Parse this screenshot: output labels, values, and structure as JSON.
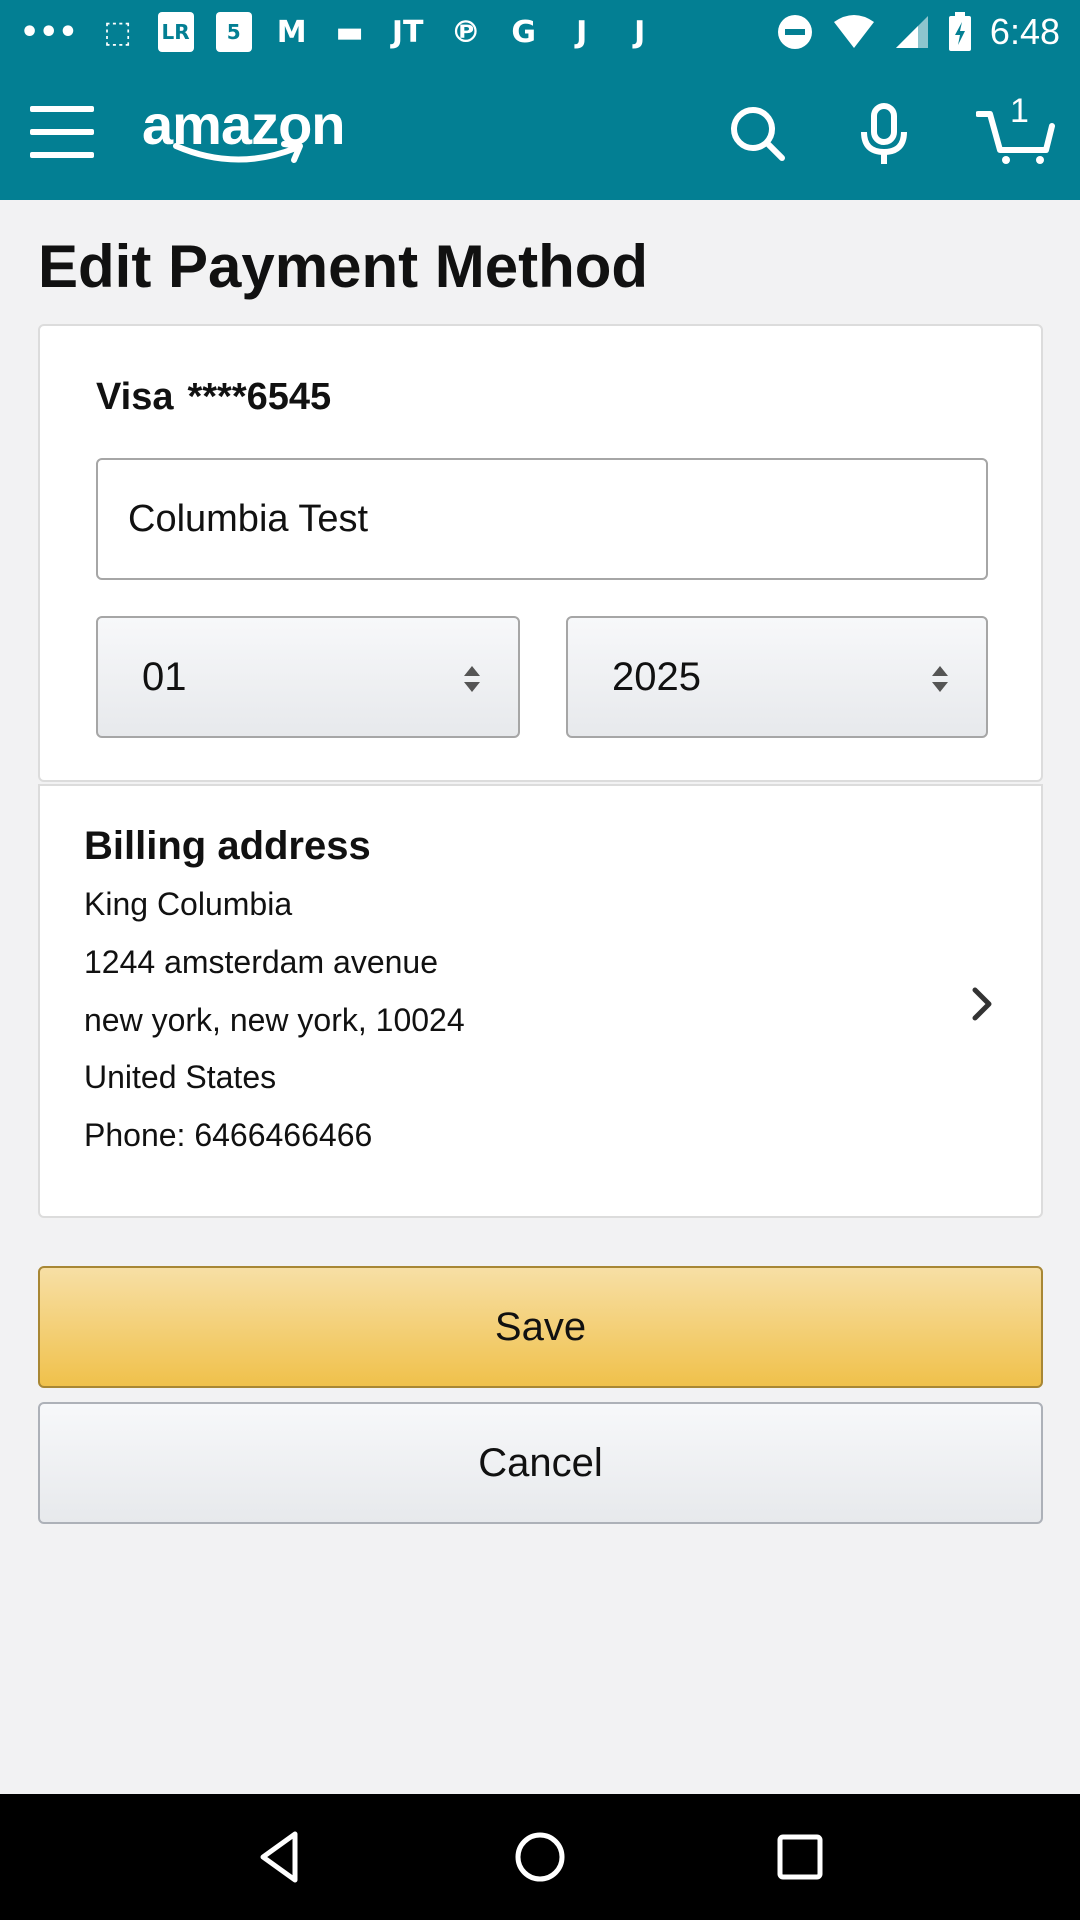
{
  "status_bar": {
    "time": "6:48",
    "left_icons": [
      "messages-icon",
      "store-icon",
      "lr-icon",
      "five-icon",
      "gmail-icon",
      "tag-icon",
      "jt-icon",
      "pinterest-icon",
      "google-icon",
      "j-icon",
      "j-icon-2"
    ],
    "icon_glyphs": [
      "•••",
      "⬚",
      "LR",
      "5",
      "M",
      "▬",
      "JT",
      "℗",
      "G",
      "J",
      "J"
    ],
    "right_icons": [
      "do-not-disturb-icon",
      "wifi-icon",
      "signal-icon",
      "battery-icon"
    ]
  },
  "header": {
    "logo_text": "amazon",
    "cart_count": "1",
    "colors": {
      "background": "#037f93"
    }
  },
  "page": {
    "title": "Edit Payment Method"
  },
  "payment_card": {
    "card_brand": "Visa",
    "card_number_masked": "****6545",
    "name_on_card": "Columbia Test",
    "expiry_month": "01",
    "expiry_year": "2025"
  },
  "billing": {
    "title": "Billing address",
    "name": "King Columbia",
    "street": "1244 amsterdam avenue",
    "city_state_zip": "new york, new york, 10024",
    "country": "United States",
    "phone": "Phone: 6466466466"
  },
  "actions": {
    "save_label": "Save",
    "cancel_label": "Cancel",
    "colors": {
      "save": "#f0c14b",
      "save_border": "#a88734"
    }
  }
}
